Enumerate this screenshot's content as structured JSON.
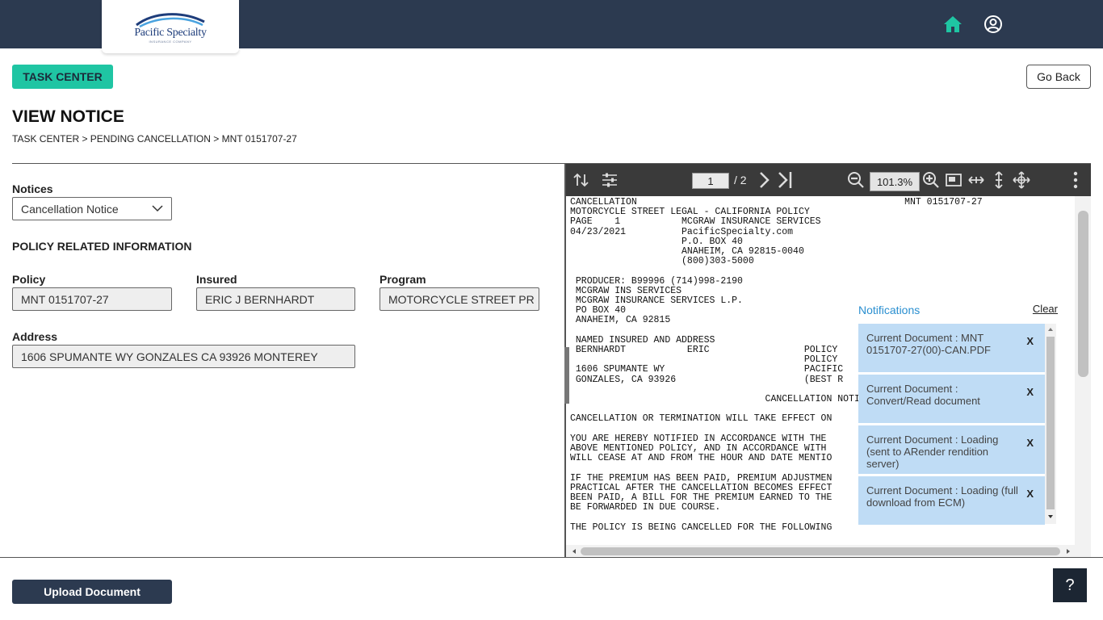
{
  "header": {
    "logo_text": "Pacific Specialty",
    "logo_subtext": "INSURANCE COMPANY",
    "home_icon": "home-icon",
    "user_icon": "user-circle-icon"
  },
  "actions": {
    "task_center": "TASK CENTER",
    "go_back": "Go Back",
    "upload_document": "Upload Document",
    "help": "?"
  },
  "page": {
    "title": "VIEW NOTICE",
    "breadcrumb": "TASK CENTER > PENDING CANCELLATION > MNT 0151707-27"
  },
  "notices": {
    "label": "Notices",
    "selected": "Cancellation Notice"
  },
  "policy_info": {
    "section_title": "POLICY RELATED INFORMATION",
    "policy_label": "Policy",
    "policy_value": "MNT 0151707-27",
    "insured_label": "Insured",
    "insured_value": "ERIC J BERNHARDT",
    "program_label": "Program",
    "program_value": "MOTORCYCLE STREET PR",
    "address_label": "Address",
    "address_value": "1606 SPUMANTE WY GONZALES CA 93926 MONTEREY"
  },
  "viewer": {
    "current_page": "1",
    "total_pages": "/ 2",
    "zoom": "101.3%",
    "document_lines": [
      "CANCELLATION                                                MNT 0151707-27",
      "MOTORCYCLE STREET LEGAL - CALIFORNIA POLICY",
      "PAGE    1           MCGRAW INSURANCE SERVICES",
      "04/23/2021          PacificSpecialty.com",
      "                    P.O. BOX 40",
      "                    ANAHEIM, CA 92815-0040",
      "                    (800)303-5000",
      "",
      " PRODUCER: B99996 (714)998-2190",
      " MCGRAW INS SERVICES",
      " MCGRAW INSURANCE SERVICES L.P.",
      " PO BOX 40",
      " ANAHEIM, CA 92815",
      "",
      " NAMED INSURED AND ADDRESS",
      " BERNHARDT           ERIC                 POLICY",
      "                                          POLICY",
      " 1606 SPUMANTE WY                         PACIFIC",
      " GONZALES, CA 93926                       (BEST R",
      "",
      "                                   CANCELLATION NOTI",
      "",
      "CANCELLATION OR TERMINATION WILL TAKE EFFECT ON",
      "",
      "YOU ARE HEREBY NOTIFIED IN ACCORDANCE WITH THE",
      "ABOVE MENTIONED POLICY, AND IN ACCORDANCE WITH",
      "WILL CEASE AT AND FROM THE HOUR AND DATE MENTIO",
      "",
      "IF THE PREMIUM HAS BEEN PAID, PREMIUM ADJUSTMEN",
      "PRACTICAL AFTER THE CANCELLATION BECOMES EFFECT",
      "BEEN PAID, A BILL FOR THE PREMIUM EARNED TO THE",
      "BE FORWARDED IN DUE COURSE.",
      "",
      "THE POLICY IS BEING CANCELLED FOR THE FOLLOWING"
    ]
  },
  "notifications": {
    "title": "Notifications",
    "clear": "Clear",
    "close_label": "X",
    "items": [
      "Current Document : MNT 0151707-27(00)-CAN.PDF",
      "Current Document : Convert/Read document",
      "Current Document : Loading (sent to ARender rendition server)",
      "Current Document : Loading (full download from ECM)"
    ]
  },
  "colors": {
    "header_bg": "#2c3a50",
    "accent_teal": "#1fc5a3",
    "notification_bg": "#bfdcf5",
    "notification_title": "#2a8fd0"
  }
}
